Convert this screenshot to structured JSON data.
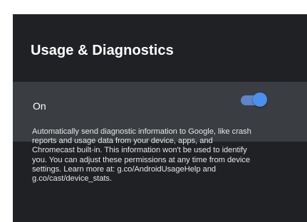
{
  "settings_panel": {
    "title": "Usage & Diagnostics",
    "setting": {
      "label": "On",
      "enabled": true,
      "toggle_color": "#4a90f0"
    },
    "description": "Automatically send diagnostic information to Google, like crash reports and usage data from your device, apps, and Chromecast built-in. This information won't be used to identify you. You can adjust these permissions at any time from device settings. Learn more at: g.co/AndroidUsageHelp and g.co/cast/device_stats."
  }
}
